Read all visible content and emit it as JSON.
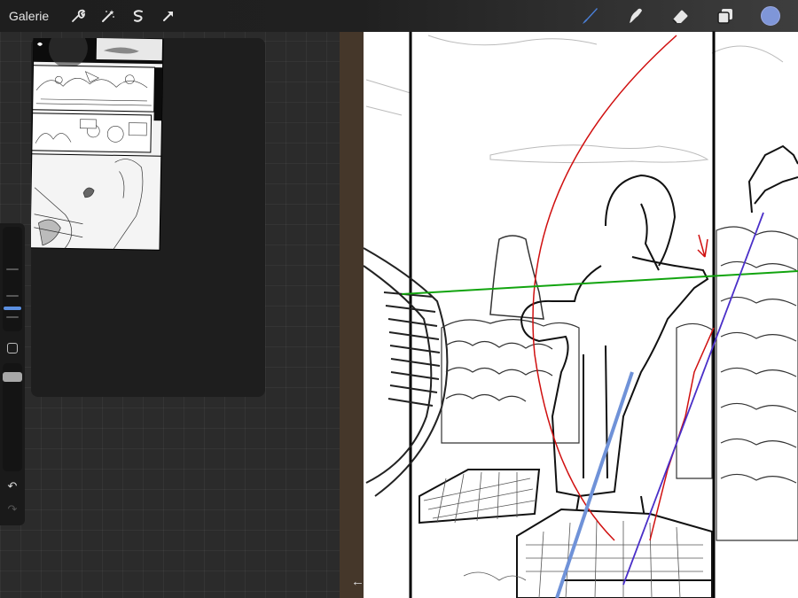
{
  "toolbar": {
    "gallery_label": "Galerie",
    "left_tools": [
      {
        "name": "actions-wrench-icon"
      },
      {
        "name": "adjustments-wand-icon"
      },
      {
        "name": "selection-s-icon"
      },
      {
        "name": "transform-arrow-icon"
      }
    ],
    "right_tools": [
      {
        "name": "brush-icon",
        "active": true,
        "color": "#4a7fd6"
      },
      {
        "name": "smudge-icon"
      },
      {
        "name": "eraser-icon"
      },
      {
        "name": "layers-icon"
      }
    ],
    "current_color": "#7f96d8"
  },
  "sidebar": {
    "brush_size_level": 0.55,
    "brush_opacity_level": 0.55
  },
  "reference_panel": {
    "visible": true
  },
  "colors": {
    "canvas_bg": "#ffffff",
    "wood": "#45372a",
    "guide_red": "#d01010",
    "guide_green": "#12a40f",
    "guide_blue": "#6f92d8",
    "guide_purple": "#4a2fc8"
  }
}
